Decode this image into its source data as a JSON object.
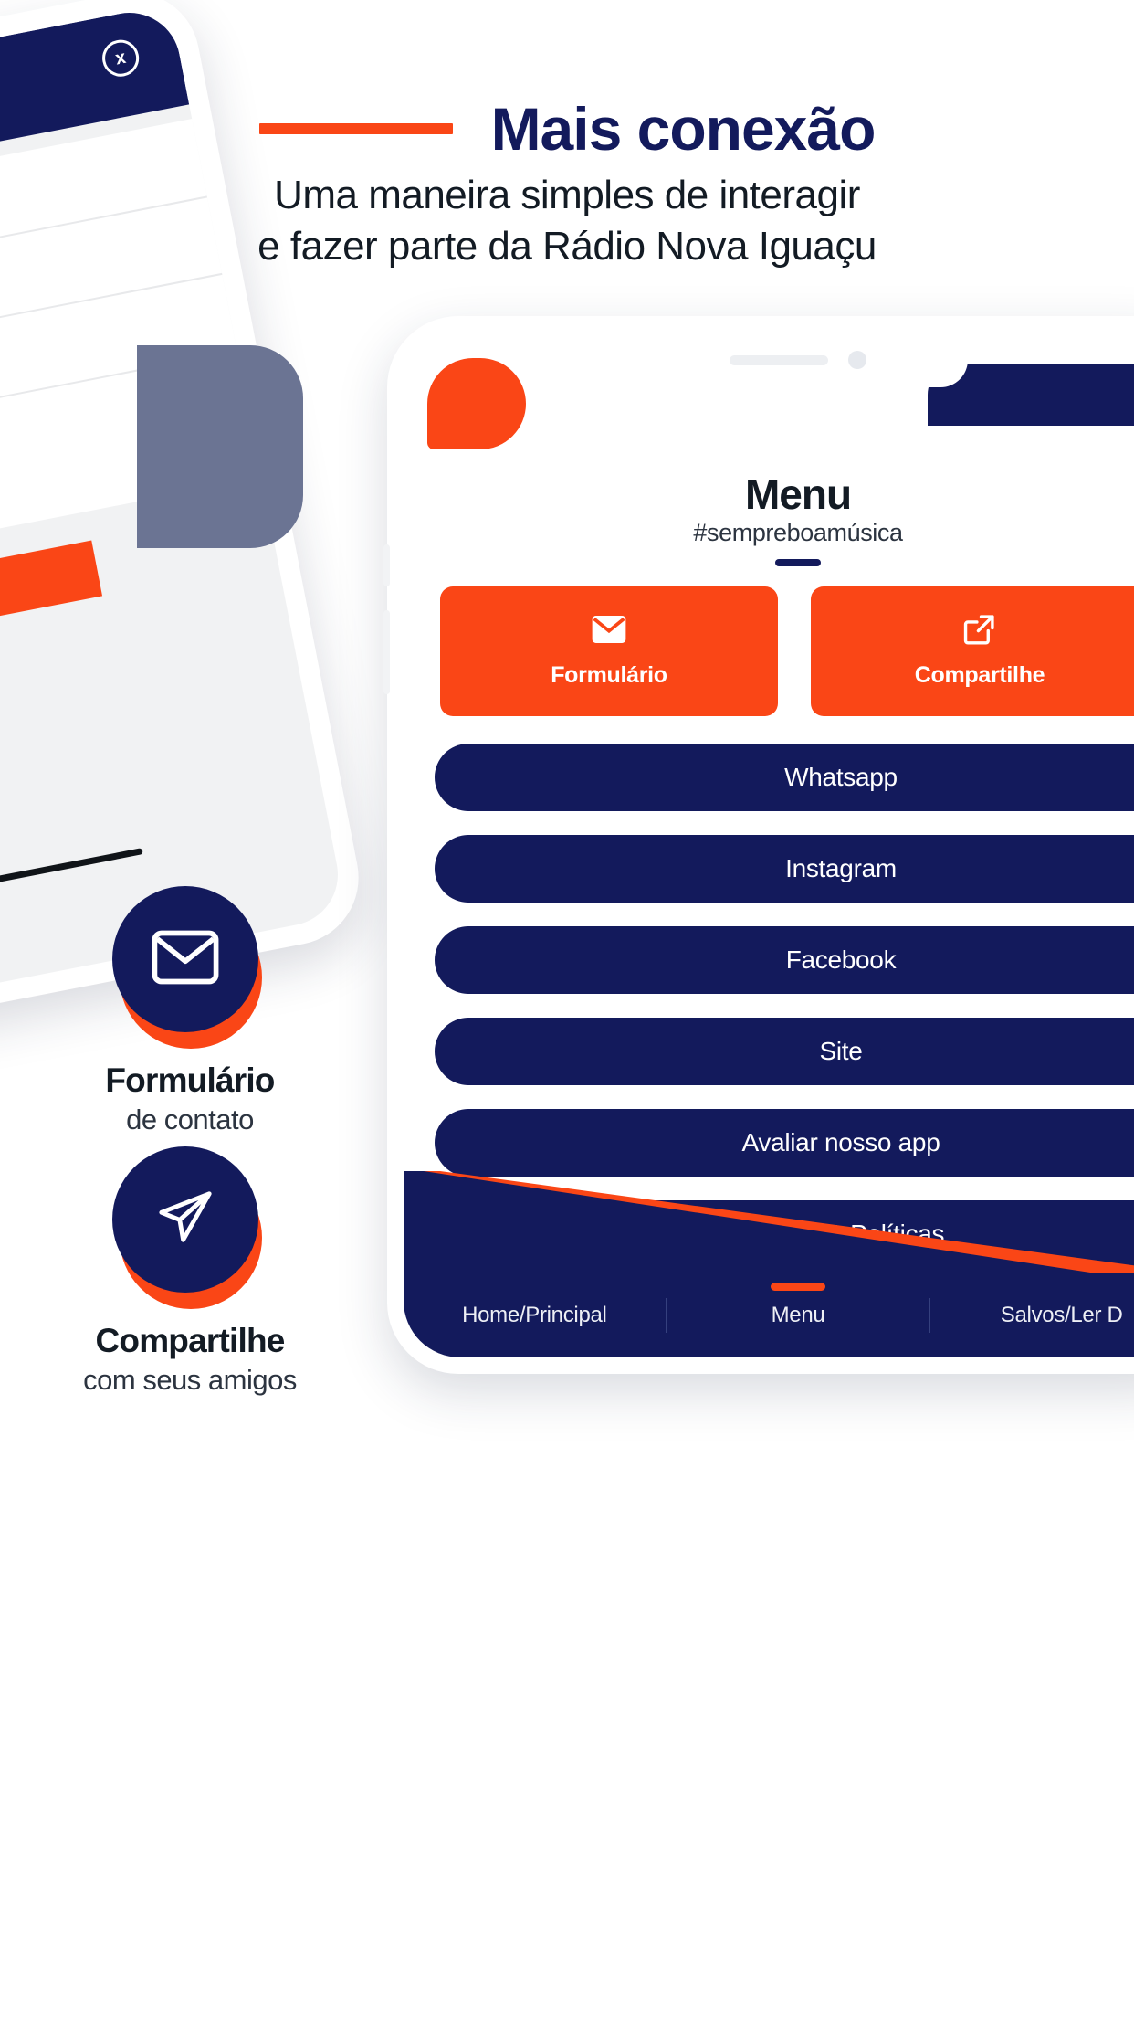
{
  "header": {
    "title": "Mais conexão",
    "subtitle_line1": "Uma maneira simples de interagir",
    "subtitle_line2": "e fazer parte da Rádio Nova Iguaçu",
    "rule_color": "#FA4616",
    "title_color": "#131A5C"
  },
  "colors": {
    "orange": "#FA4616",
    "navy": "#131A5C",
    "gray_blob": "#6B7493",
    "text_dark": "#131B24"
  },
  "phone_left": {
    "close_icon_label": "x",
    "name": "tilted-phone-mockup"
  },
  "phone_screen": {
    "title": "Menu",
    "hashtag": "#sempreboamúsica",
    "tiles": [
      {
        "label": "Formulário",
        "icon": "envelope-icon"
      },
      {
        "label": "Compartilhe",
        "icon": "share-icon"
      }
    ],
    "links": [
      "Whatsapp",
      "Instagram",
      "Facebook",
      "Site",
      "Avaliar nosso app",
      "Termos & Políticas"
    ],
    "bottom_nav": [
      {
        "label": "Home/Principal",
        "active": false
      },
      {
        "label": "Menu",
        "active": true
      },
      {
        "label": "Salvos/Ler D",
        "active": false
      }
    ]
  },
  "features": [
    {
      "icon": "envelope-icon",
      "title": "Formulário",
      "subtitle": "de contato"
    },
    {
      "icon": "send-icon",
      "title": "Compartilhe",
      "subtitle": "com seus amigos"
    }
  ]
}
